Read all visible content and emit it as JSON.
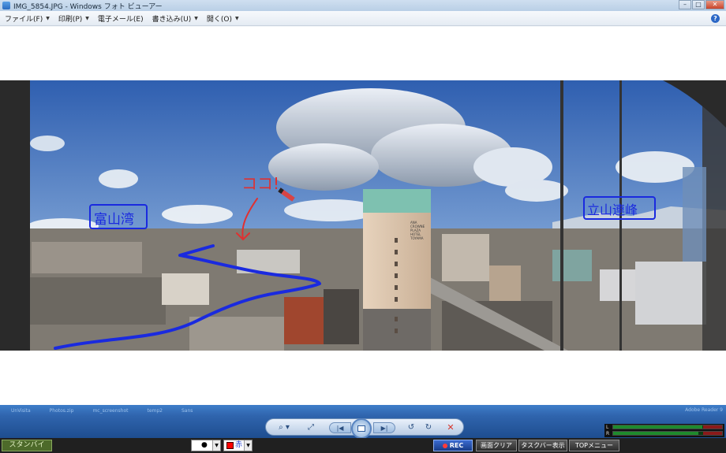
{
  "window": {
    "title": "IMG_5854.JPG - Windows フォト ビューアー",
    "buttons": {
      "minimize": "–",
      "maximize": "□",
      "close": "✕"
    }
  },
  "menu": {
    "items": [
      {
        "label": "ファイル(F)",
        "caret": "▼"
      },
      {
        "label": "印刷(P)",
        "caret": "▼"
      },
      {
        "label": "電子メール(E)"
      },
      {
        "label": "書き込み(U)",
        "caret": "▼"
      },
      {
        "label": "開く(O)",
        "caret": "▼"
      }
    ],
    "help": "?"
  },
  "photo": {
    "annotations": {
      "left": "富山湾",
      "center": "ココ!",
      "right": "立山連峰"
    },
    "hotel_sign": [
      "ANA",
      "CROWNE",
      "PLAZA",
      "HOTEL",
      "TOYAMA"
    ],
    "colors": {
      "sky_top": "#2f5fb0",
      "sky_bottom": "#9bbbe0",
      "ink_blue": "#1a2adf",
      "ink_red": "#e03030"
    }
  },
  "background_taskbar": {
    "items": [
      "UnVisita",
      "Photos.zip",
      "mc_screenshot",
      "temp2",
      "Sans"
    ],
    "right": "Adobe Reader 9"
  },
  "controls": {
    "zoom": "⌕ ▾",
    "fit": "⤢",
    "prev": "|◀",
    "next": "▶|",
    "rotate_left": "↺",
    "rotate_right": "↻",
    "delete": "✕"
  },
  "status": {
    "standby": "スタンバイ",
    "pen_size": "●",
    "color_label": "赤",
    "color_hex": "#ff0000",
    "dropdown_arrow": "▼",
    "rec": "REC",
    "clear": "画面クリア",
    "taskbar_show": "タスクバー表示",
    "top_menu": "TOPメニュー",
    "meter": {
      "labels": [
        "L",
        "R"
      ],
      "level_left": 0.82,
      "level_right": 0.78
    }
  }
}
